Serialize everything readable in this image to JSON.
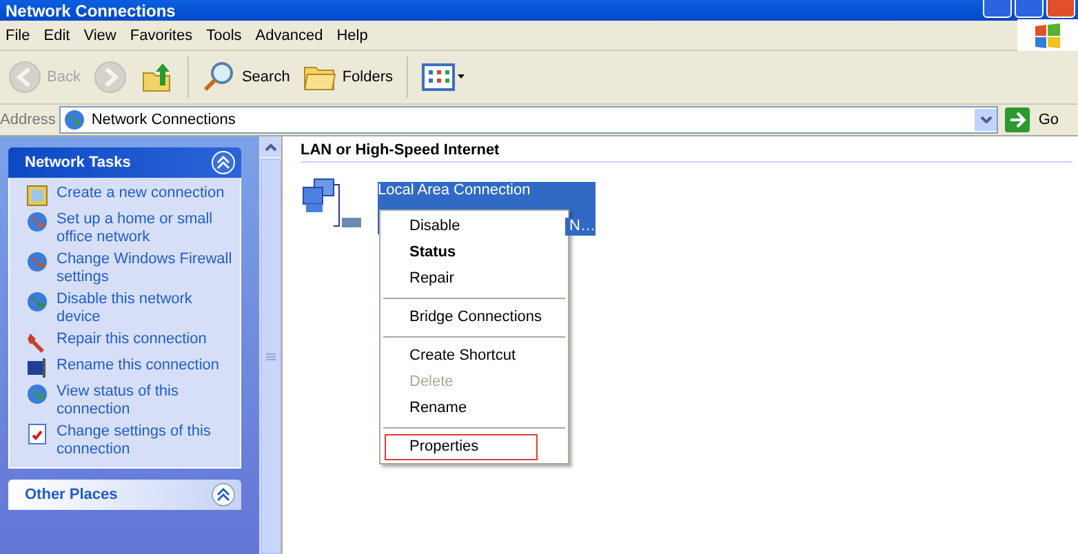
{
  "window": {
    "title": "Network Connections"
  },
  "menu_bar": [
    "File",
    "Edit",
    "View",
    "Favorites",
    "Tools",
    "Advanced",
    "Help"
  ],
  "toolbar": [
    {
      "kind": "back",
      "label": "Back",
      "disabled": true
    },
    {
      "kind": "forward",
      "disabled": true
    },
    {
      "kind": "up",
      "disabled": false
    },
    {
      "kind": "search",
      "label": "Search",
      "disabled": false
    },
    {
      "kind": "folders",
      "label": "Folders",
      "disabled": false
    },
    {
      "kind": "views",
      "disabled": false
    }
  ],
  "address_bar": {
    "label": "Address",
    "value": "Network Connections",
    "go": "Go"
  },
  "task_panels": [
    {
      "title": "Network Tasks",
      "expanded": true,
      "items": [
        {
          "text": "Create a new connection"
        },
        {
          "text": "Set up a home or small office network"
        },
        {
          "text": "Change Windows Firewall settings"
        },
        {
          "text": "Disable this network device"
        },
        {
          "text": "Repair this connection"
        },
        {
          "text": "Rename this connection"
        },
        {
          "text": "View status of this connection"
        },
        {
          "text": "Change settings of this connection"
        }
      ]
    },
    {
      "title": "Other Places",
      "expanded": true
    }
  ],
  "group_header": "LAN or High-Speed Internet",
  "connection": {
    "name": "Local Area Connection",
    "tail": "N…",
    "selected": true
  },
  "context_menu": [
    {
      "kind": "item",
      "label": "Disable",
      "bold": false,
      "disabled": false,
      "highlighted": false
    },
    {
      "kind": "item",
      "label": "Status",
      "bold": true,
      "disabled": false,
      "highlighted": false
    },
    {
      "kind": "item",
      "label": "Repair",
      "bold": false,
      "disabled": false,
      "highlighted": false
    },
    {
      "kind": "separator"
    },
    {
      "kind": "item",
      "label": "Bridge Connections",
      "bold": false,
      "disabled": false,
      "highlighted": false
    },
    {
      "kind": "separator"
    },
    {
      "kind": "item",
      "label": "Create Shortcut",
      "bold": false,
      "disabled": false,
      "highlighted": false
    },
    {
      "kind": "item",
      "label": "Delete",
      "bold": false,
      "disabled": true,
      "highlighted": false
    },
    {
      "kind": "item",
      "label": "Rename",
      "bold": false,
      "disabled": false,
      "highlighted": false
    },
    {
      "kind": "separator"
    },
    {
      "kind": "item",
      "label": "Properties",
      "bold": false,
      "disabled": false,
      "highlighted": true
    }
  ]
}
